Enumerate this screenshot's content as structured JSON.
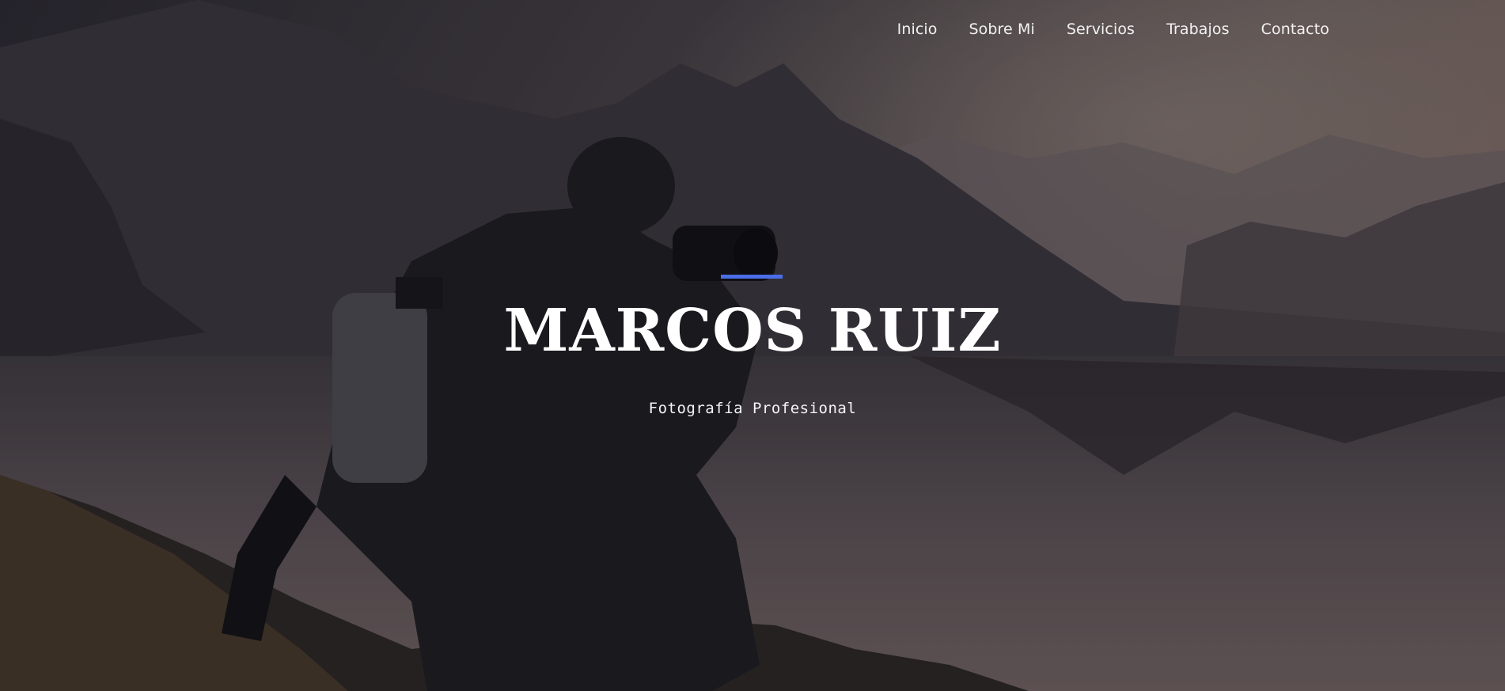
{
  "nav": {
    "items": [
      {
        "label": "Inicio"
      },
      {
        "label": "Sobre Mi"
      },
      {
        "label": "Servicios"
      },
      {
        "label": "Trabajos"
      },
      {
        "label": "Contacto"
      }
    ]
  },
  "hero": {
    "title": "MARCOS RUIZ",
    "subtitle": "Fotografía Profesional",
    "accent_color": "#4a6ee8",
    "background_image": "photographer-on-mountain-lake-image"
  }
}
